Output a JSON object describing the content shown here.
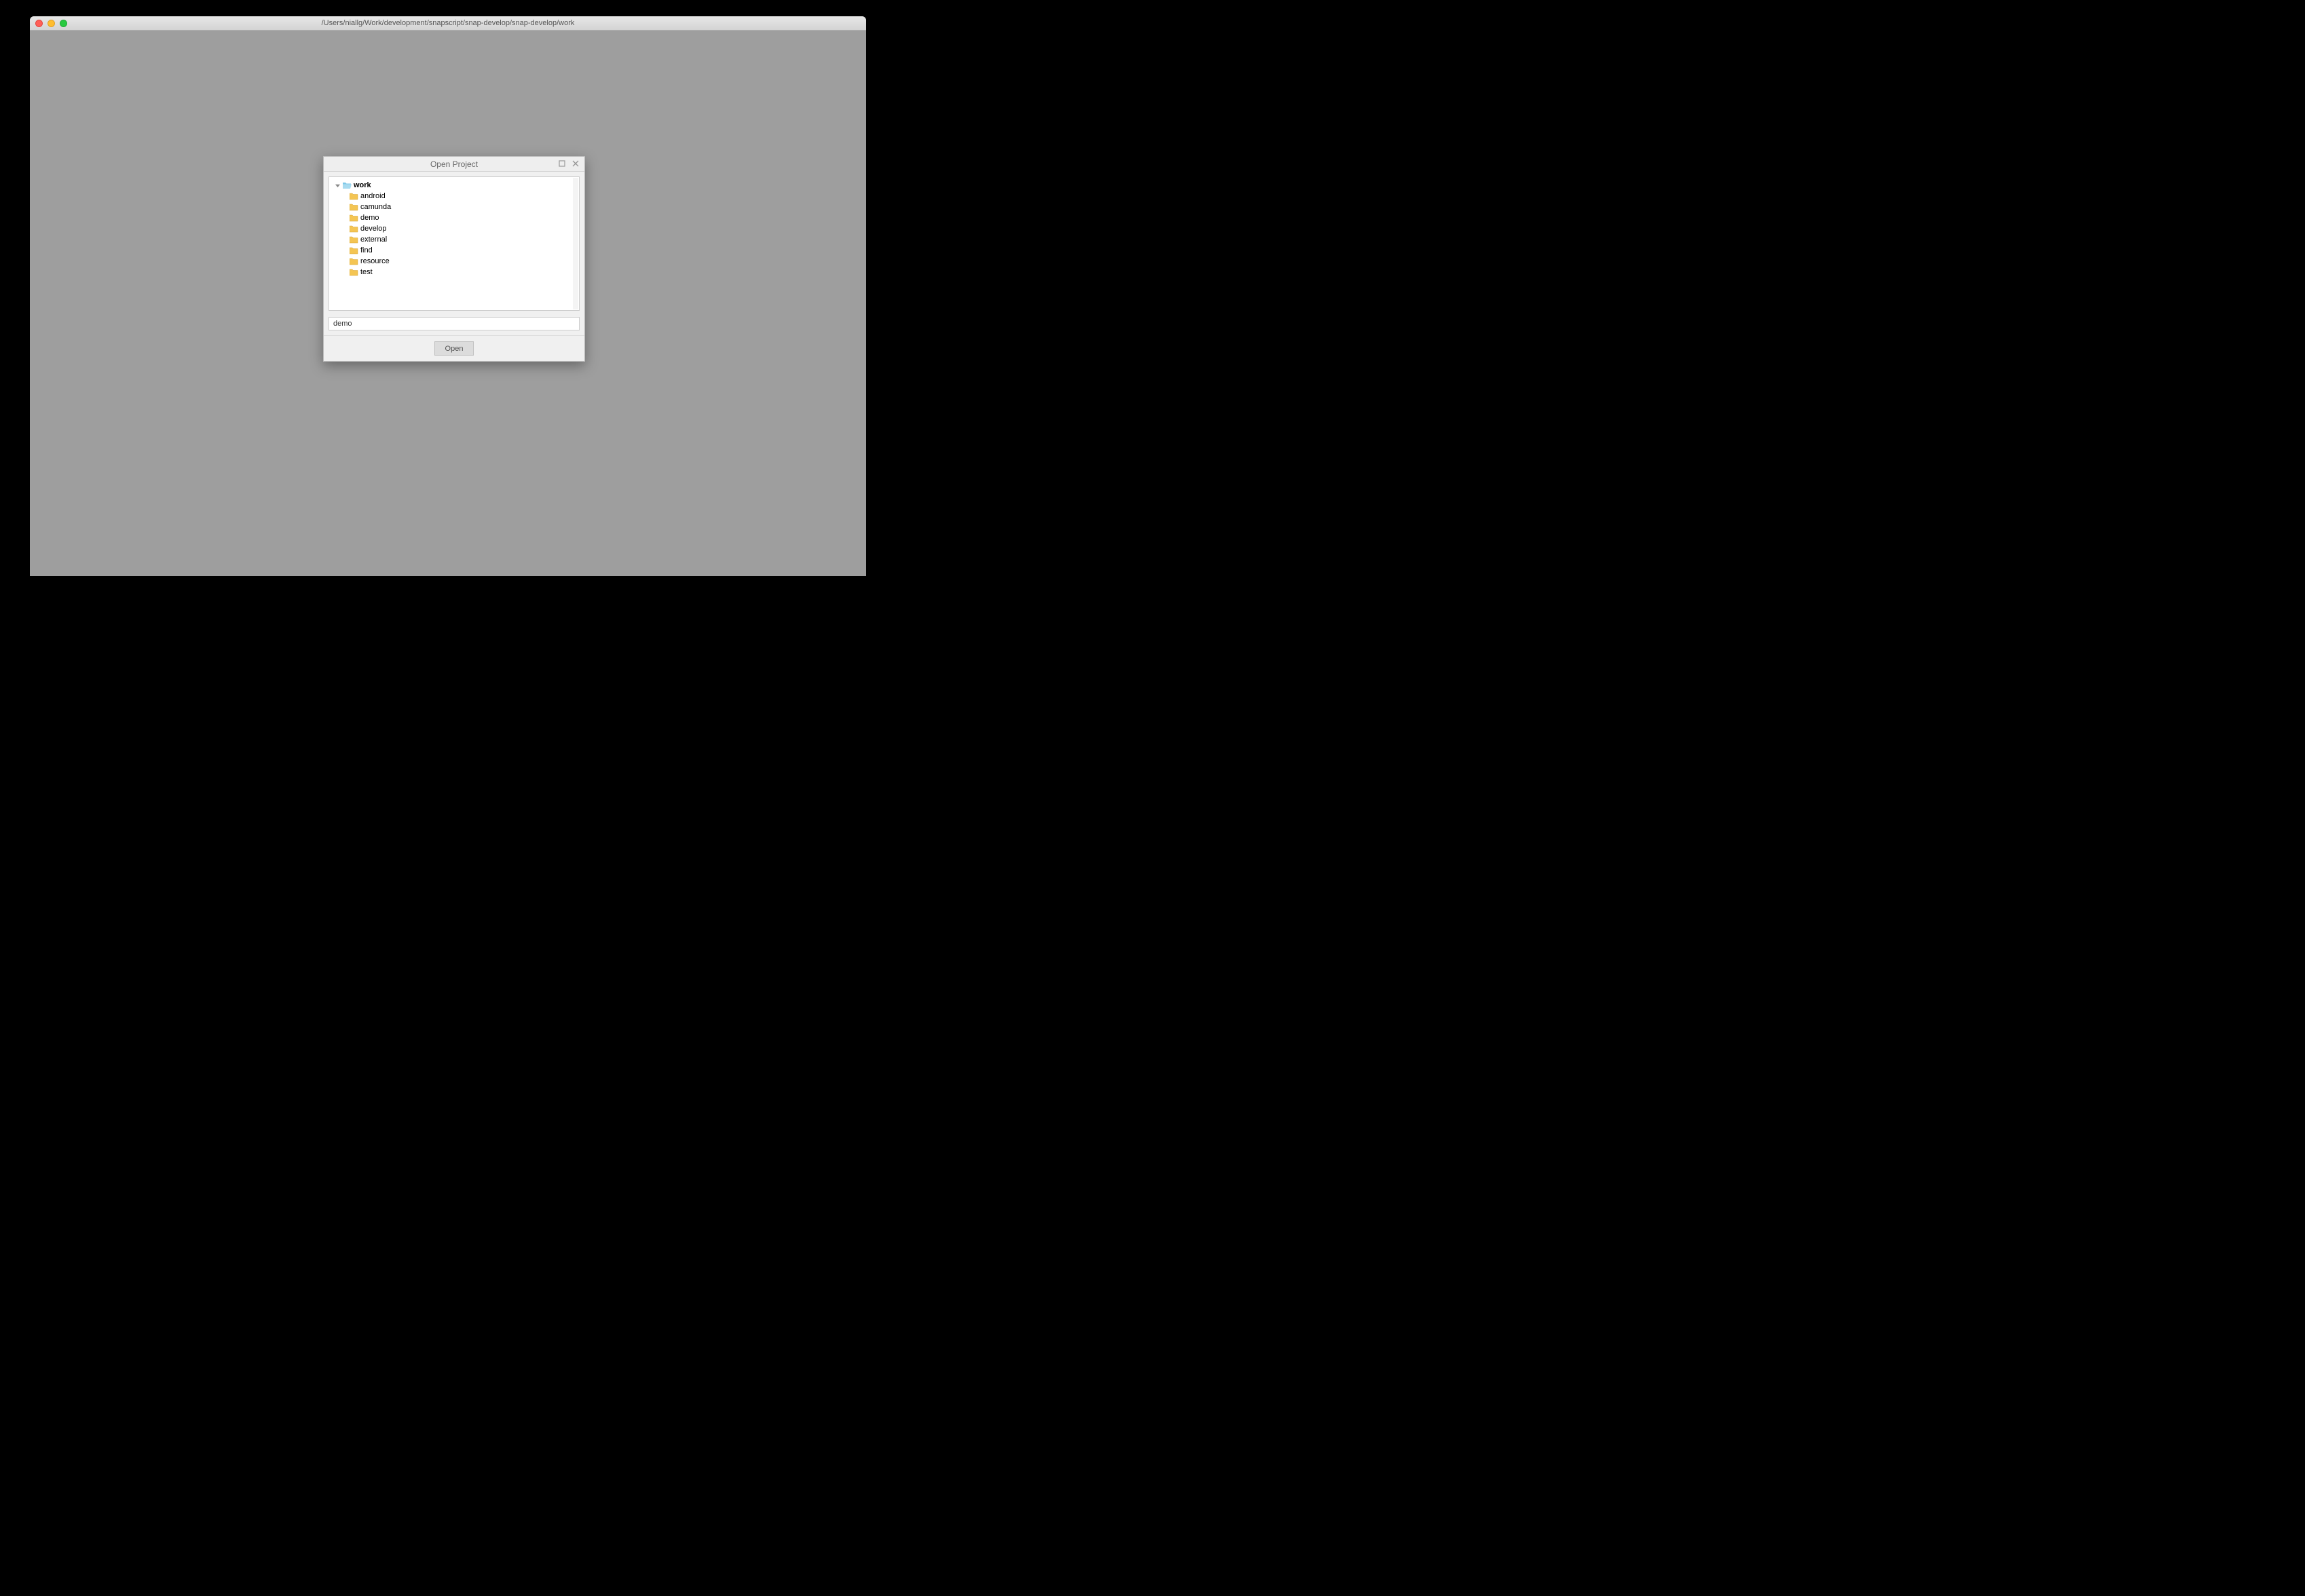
{
  "window": {
    "title": "/Users/niallg/Work/development/snapscript/snap-develop/snap-develop/work"
  },
  "dialog": {
    "title": "Open Project",
    "input_value": "demo",
    "open_button_label": "Open",
    "maximize_icon": "maximize-icon",
    "close_icon": "close-icon",
    "tree": {
      "root": {
        "label": "work",
        "expanded": true
      },
      "children": [
        {
          "label": "android"
        },
        {
          "label": "camunda"
        },
        {
          "label": "demo"
        },
        {
          "label": "develop"
        },
        {
          "label": "external"
        },
        {
          "label": "find"
        },
        {
          "label": "resource"
        },
        {
          "label": "test"
        }
      ]
    }
  }
}
